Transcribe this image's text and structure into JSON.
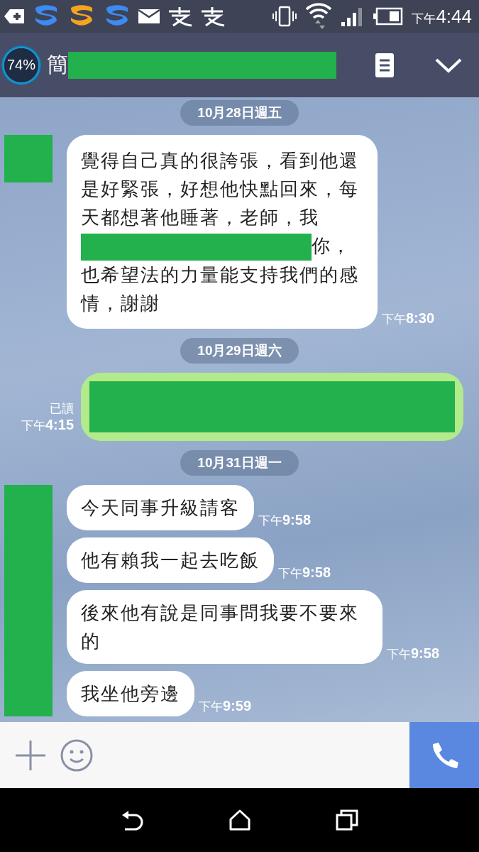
{
  "status_bar": {
    "time_prefix": "下午",
    "time": "4:44"
  },
  "header": {
    "battery_widget": "74%",
    "title": "簡",
    "title_redacted": true
  },
  "messages": [
    {
      "kind": "date",
      "text": "10月28日週五"
    },
    {
      "kind": "received",
      "avatar_redacted": true,
      "parts": [
        {
          "kind": "text",
          "text": "覺得自己真的很誇張，看到他還是好緊張，好想他快點回來，每天都想著他睡著，老師，我"
        },
        {
          "kind": "redacted"
        },
        {
          "kind": "text",
          "text": "你，也希望法的力量能支持我們的感情，謝謝"
        }
      ],
      "time_prefix": "下午",
      "time": "8:30"
    },
    {
      "kind": "date",
      "text": "10月29日週六"
    },
    {
      "kind": "sent",
      "parts": [
        {
          "kind": "redacted"
        }
      ],
      "read": "已讀",
      "time_prefix": "下午",
      "time": "4:15"
    },
    {
      "kind": "date",
      "text": "10月31日週一"
    },
    {
      "kind": "group",
      "avatar_redacted": true,
      "items": [
        {
          "text": "今天同事升級請客",
          "time_prefix": "下午",
          "time": "9:58"
        },
        {
          "text": "他有賴我一起去吃飯",
          "time_prefix": "下午",
          "time": "9:58"
        },
        {
          "text": "後來他有說是同事問我要不要來的",
          "time_prefix": "下午",
          "time": "9:58"
        },
        {
          "text": "我坐他旁邊",
          "time_prefix": "下午",
          "time": "9:59"
        }
      ]
    }
  ]
}
